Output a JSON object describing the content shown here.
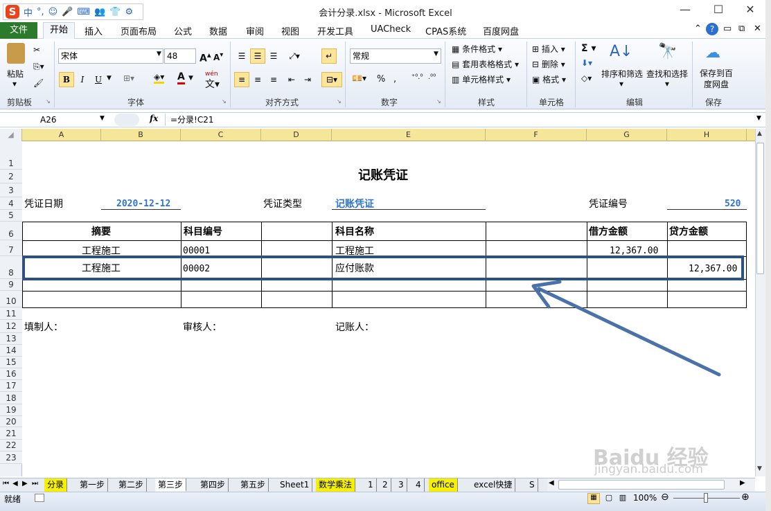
{
  "title_bar": {
    "title": "会计分录.xlsx - Microsoft Excel",
    "ime_labels": [
      "中",
      "°,",
      "☺",
      "🎤",
      "⌨",
      "👥",
      "👕",
      "⚙"
    ]
  },
  "tabs": [
    {
      "label": "文件"
    },
    {
      "label": "开始"
    },
    {
      "label": "插入"
    },
    {
      "label": "页面布局"
    },
    {
      "label": "公式"
    },
    {
      "label": "数据"
    },
    {
      "label": "审阅"
    },
    {
      "label": "视图"
    },
    {
      "label": "开发工具"
    },
    {
      "label": "UACheck"
    },
    {
      "label": "CPAS系统"
    },
    {
      "label": "百度网盘"
    }
  ],
  "ribbon": {
    "paste_label": "粘贴",
    "font_name": "宋体",
    "font_size": "48",
    "number_format": "常规",
    "group_labels": {
      "clipboard": "剪贴板",
      "font": "字体",
      "alignment": "对齐方式",
      "number": "数字",
      "styles": "样式",
      "cells": "单元格",
      "editing": "编辑",
      "save": "保存"
    },
    "styles": {
      "conditional": "条件格式",
      "table": "套用表格格式",
      "cell_styles": "单元格样式"
    },
    "cells": {
      "insert": "插入",
      "delete": "删除",
      "format": "格式"
    },
    "editing": {
      "sort_filter": "排序和筛选",
      "find_select": "查找和选择"
    },
    "save_btn": "保存到百度网盘",
    "percent": "%",
    "bold": "B",
    "italic": "I",
    "underline": "U",
    "wen": "wén"
  },
  "formula_bar": {
    "name_box": "A26",
    "fx": "fx",
    "formula": "=分录!C21"
  },
  "columns": [
    "A",
    "B",
    "C",
    "D",
    "E",
    "F",
    "G",
    "H"
  ],
  "rows": [
    "1",
    "2",
    "3",
    "4",
    "5",
    "6",
    "7",
    "8",
    "9",
    "10",
    "11",
    "12",
    "13",
    "14",
    "15",
    "16",
    "17",
    "18",
    "19",
    "20",
    "21",
    "22",
    "23"
  ],
  "sheet": {
    "voucher_title": "记账凭证",
    "date_label": "凭证日期",
    "date_value": "2020-12-12",
    "type_label": "凭证类型",
    "type_value": "记账凭证",
    "number_label": "凭证编号",
    "number_value": "520",
    "headers": {
      "summary": "摘要",
      "code": "科目编号",
      "name": "科目名称",
      "debit": "借方金额",
      "credit": "贷方金额"
    },
    "row6": {
      "summary": "工程施工",
      "code": "00001",
      "name": "工程施工",
      "debit": "12,367.00"
    },
    "row7": {
      "summary": "工程施工",
      "code": "00002",
      "name": "应付账款",
      "credit": "12,367.00"
    },
    "maker": "填制人：",
    "reviewer": "审核人：",
    "bookkeeper": "记账人："
  },
  "sheet_tabs": [
    "分录",
    "第一步",
    "第二步",
    "第三步",
    "第四步",
    "第五步",
    "Sheet1",
    "数学乘法",
    "1",
    "2",
    "3",
    "4",
    "office",
    "excel快捷",
    "S"
  ],
  "status": {
    "ready": "就绪",
    "zoom": "100%"
  },
  "watermark": {
    "site": "jingyan.baidu.com"
  }
}
